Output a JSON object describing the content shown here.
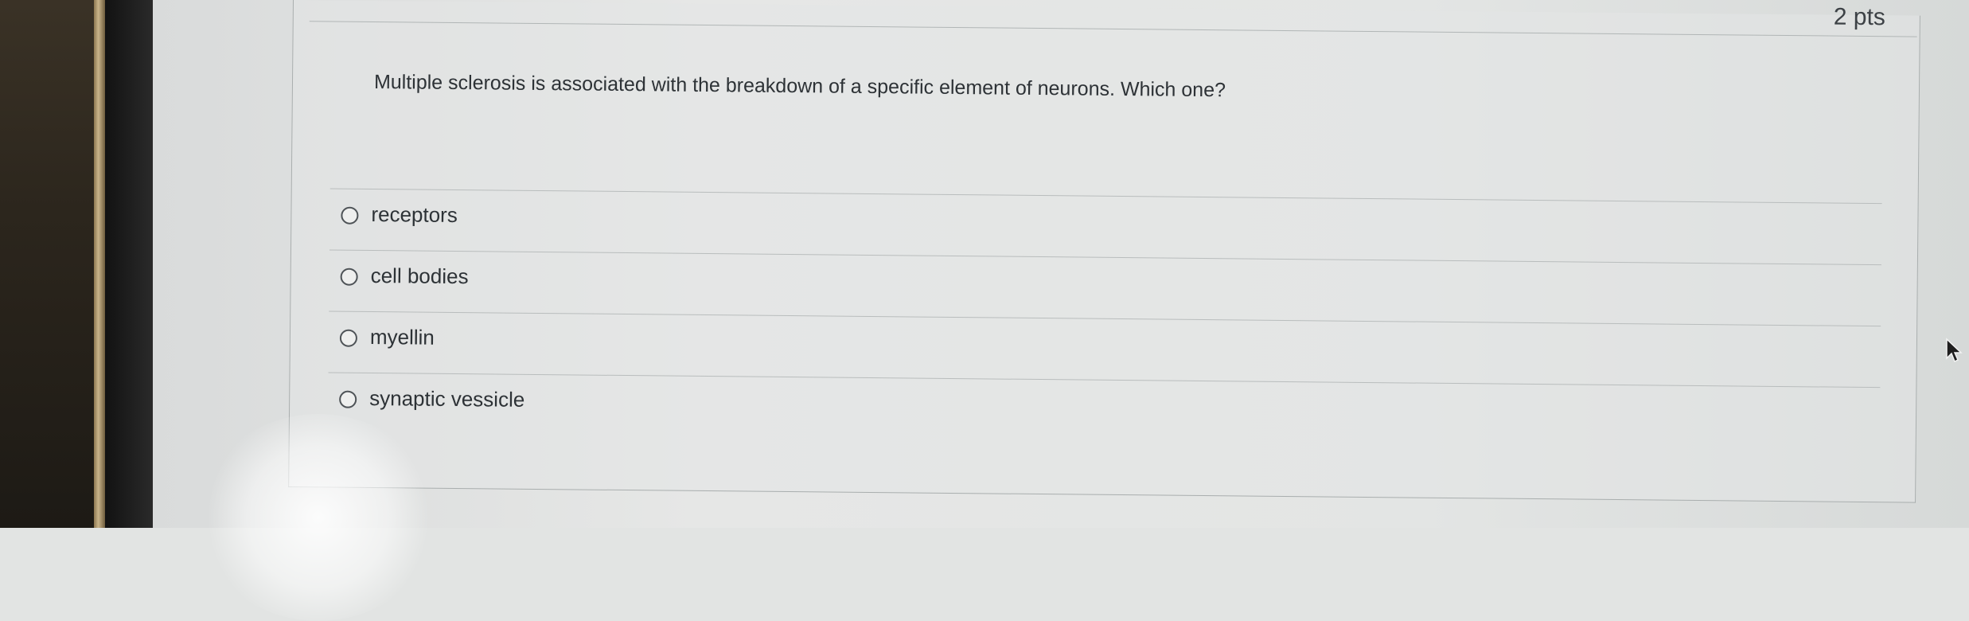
{
  "question": {
    "points": "2 pts",
    "text": "Multiple sclerosis is associated with the breakdown of a specific element of neurons.  Which one?",
    "answers": [
      {
        "label": "receptors",
        "selected": false
      },
      {
        "label": "cell bodies",
        "selected": false
      },
      {
        "label": "myellin",
        "selected": false
      },
      {
        "label": "synaptic vessicle",
        "selected": false
      }
    ]
  },
  "icons": {
    "answer_radio": "radio-button-unchecked",
    "cursor": "mouse-pointer-arrow"
  },
  "colors": {
    "text": "#2d3236",
    "border": "#a9aeae",
    "background": "#e3e5e4"
  }
}
